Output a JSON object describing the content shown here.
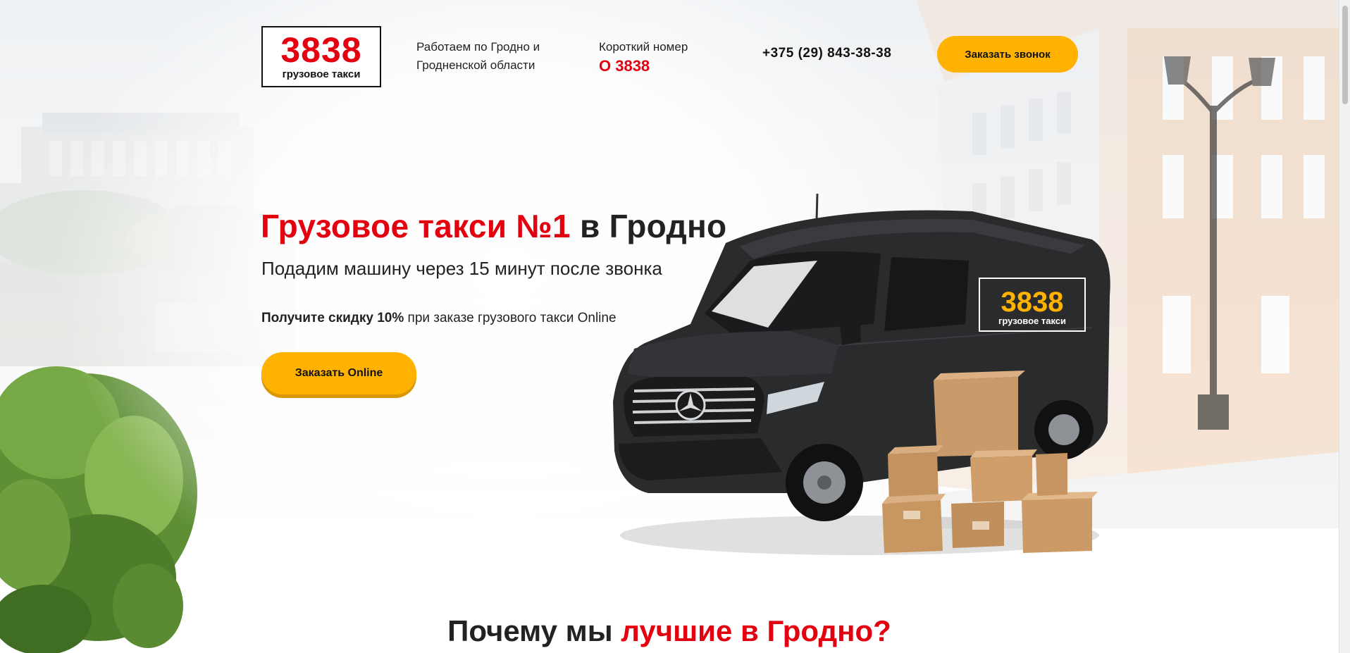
{
  "header": {
    "logo": {
      "number": "3838",
      "subtitle": "грузовое такси"
    },
    "region_line1": "Работаем по Гродно и",
    "region_line2": "Гродненской области",
    "short_number_label": "Короткий номер",
    "short_number": "О 3838",
    "phone": "+375 (29) 843-38-38",
    "call_button": "Заказать звонок"
  },
  "hero": {
    "title_accent": "Грузовое такси №1",
    "title_rest": " в Гродно",
    "subtitle": "Подадим машину через 15 минут после звонка",
    "promo_bold": "Получите скидку 10%",
    "promo_rest": " при заказе грузового такси Online",
    "online_button": "Заказать Online",
    "van_logo_number": "3838",
    "van_logo_subtitle": "грузовое такси"
  },
  "section_why": {
    "title_start": "Почему мы ",
    "title_accent": "лучшие в Гродно?"
  },
  "colors": {
    "brand_red": "#e3000f",
    "button_yellow": "#ffb300",
    "text_dark": "#222222",
    "van_body": "#2a2b2d",
    "box_cardboard": "#c99a6a"
  },
  "icons": [
    "van-image",
    "cardboard-boxes-image",
    "tree-image",
    "street-lamp-image"
  ]
}
